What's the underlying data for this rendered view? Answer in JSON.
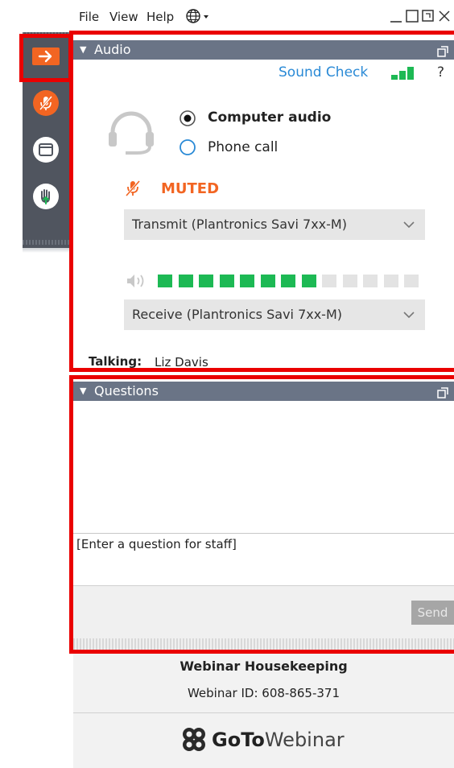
{
  "menu": {
    "file": "File",
    "view": "View",
    "help": "Help"
  },
  "audio": {
    "header": "Audio",
    "sound_check": "Sound Check",
    "help": "?",
    "options": [
      "Computer audio",
      "Phone call"
    ],
    "selected_option": "Computer audio",
    "muted_label": "MUTED",
    "transmit_device": "Transmit (Plantronics Savi 7xx-M)",
    "receive_device": "Receive (Plantronics Savi 7xx-M)",
    "speaker_level": {
      "lit": 8,
      "total": 13
    },
    "talking_label": "Talking:",
    "talking_name": "Liz Davis"
  },
  "questions": {
    "header": "Questions",
    "placeholder": "[Enter a question for staff]",
    "send_label": "Send"
  },
  "footer": {
    "title": "Webinar Housekeeping",
    "webinar_id": "Webinar ID: 608-865-371",
    "brand_bold": "GoTo",
    "brand_light": "Webinar"
  },
  "colors": {
    "accent_orange": "#f26522",
    "level_green": "#1db954",
    "header_blue_gray": "#6a7486",
    "highlight_red": "#ea0000"
  }
}
